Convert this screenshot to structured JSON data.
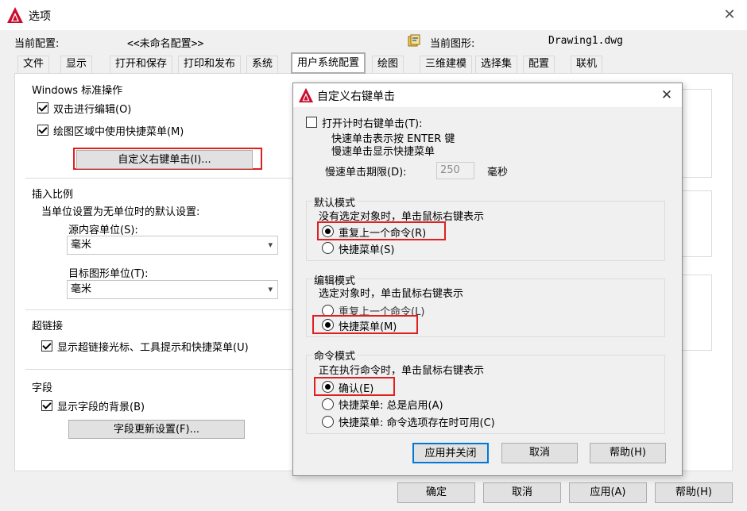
{
  "window": {
    "title": "选项",
    "icon": "autocad-logo-icon",
    "close_icon": "close-icon"
  },
  "header": {
    "profile_label": "当前配置:",
    "profile_value": "<<未命名配置>>",
    "drawing_label": "当前图形:",
    "drawing_value": "Drawing1.dwg",
    "drawing_icon": "drawing-file-icon"
  },
  "tabs": [
    {
      "label": "文件"
    },
    {
      "label": "显示"
    },
    {
      "label": "打开和保存"
    },
    {
      "label": "打印和发布"
    },
    {
      "label": "系统"
    },
    {
      "label": "用户系统配置",
      "active": true
    },
    {
      "label": "绘图"
    },
    {
      "label": "三维建模"
    },
    {
      "label": "选择集"
    },
    {
      "label": "配置"
    },
    {
      "label": "联机"
    }
  ],
  "windows_ops": {
    "title": "Windows 标准操作",
    "double_click_edit": "双击进行编辑(O)",
    "shortcut_menu": "绘图区域中使用快捷菜单(M)",
    "custom_right_click_btn": "自定义右键单击(I)..."
  },
  "insert_scale": {
    "title": "插入比例",
    "desc": "当单位设置为无单位时的默认设置:",
    "source_label": "源内容单位(S):",
    "source_value": "毫米",
    "target_label": "目标图形单位(T):",
    "target_value": "毫米"
  },
  "hyperlink": {
    "title": "超链接",
    "show_cursor": "显示超链接光标、工具提示和快捷菜单(U)"
  },
  "field": {
    "title": "字段",
    "show_background": "显示字段的背景(B)",
    "update_settings_btn": "字段更新设置(F)..."
  },
  "modal": {
    "title": "自定义右键单击",
    "timed_right_click": "打开计时右键单击(T):",
    "quick_click_desc": "快速单击表示按 ENTER 键",
    "slow_click_desc": "慢速单击显示快捷菜单",
    "slow_click_label": "慢速单击期限(D):",
    "slow_click_value": "250",
    "slow_click_unit": "毫秒",
    "default_mode": {
      "title": "默认模式",
      "desc": "没有选定对象时，单击鼠标右键表示",
      "repeat_last": "重复上一个命令(R)",
      "shortcut_menu": "快捷菜单(S)"
    },
    "edit_mode": {
      "title": "编辑模式",
      "desc": "选定对象时，单击鼠标右键表示",
      "repeat_last": "重复上一个命令(L)",
      "shortcut_menu": "快捷菜单(M)"
    },
    "command_mode": {
      "title": "命令模式",
      "desc": "正在执行命令时，单击鼠标右键表示",
      "confirm": "确认(E)",
      "menu_always": "快捷菜单: 总是启用(A)",
      "menu_options": "快捷菜单: 命令选项存在时可用(C)"
    },
    "apply_close": "应用并关闭",
    "cancel": "取消",
    "help": "帮助(H)"
  },
  "footer": {
    "ok": "确定",
    "cancel": "取消",
    "apply": "应用(A)",
    "help": "帮助(H)"
  },
  "colors": {
    "highlight_border": "#e02020",
    "focus_border": "#0078d7",
    "accent_red": "#c8102e"
  }
}
